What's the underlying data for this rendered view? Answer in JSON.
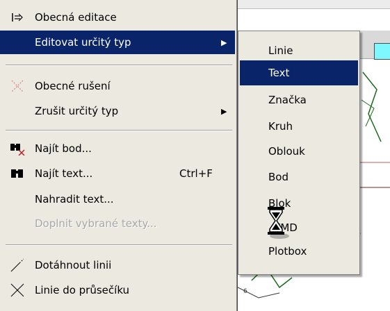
{
  "menu": {
    "items": [
      {
        "label": "Obecná editace",
        "icon": "arrow-into-bar-icon"
      },
      {
        "label": "Editovat určitý typ",
        "selected": true,
        "submenu": true
      },
      {
        "label": "Obecné rušení",
        "icon": "dotted-x-icon"
      },
      {
        "label": "Zrušit určitý typ",
        "submenu": true
      },
      {
        "label": "Najít bod...",
        "icon": "binoculars-point-icon"
      },
      {
        "label": "Najít text...",
        "shortcut": "Ctrl+F",
        "icon": "binoculars-icon"
      },
      {
        "label": "Nahradit text..."
      },
      {
        "label": "Doplnit vybrané texty...",
        "disabled": true
      },
      {
        "label": "Dotáhnout linii",
        "icon": "extend-line-icon"
      },
      {
        "label": "Linie do průsečíku",
        "icon": "intersect-lines-icon"
      }
    ]
  },
  "submenu": {
    "items": [
      {
        "label": "Linie"
      },
      {
        "label": "Text",
        "selected": true
      },
      {
        "label": "Značka"
      },
      {
        "label": "Kruh"
      },
      {
        "label": "Oblouk"
      },
      {
        "label": "Bod"
      },
      {
        "label": "Blok"
      },
      {
        "label": "_KMD"
      },
      {
        "label": "Plotbox"
      }
    ]
  },
  "colors": {
    "menu_bg": "#ebe9e0",
    "selection": "#0a246a",
    "selection_text": "#ffffff",
    "disabled_text": "#a8a8a8",
    "swatch": "#7ff7ff"
  },
  "cursor": "hourglass-cursor-icon"
}
